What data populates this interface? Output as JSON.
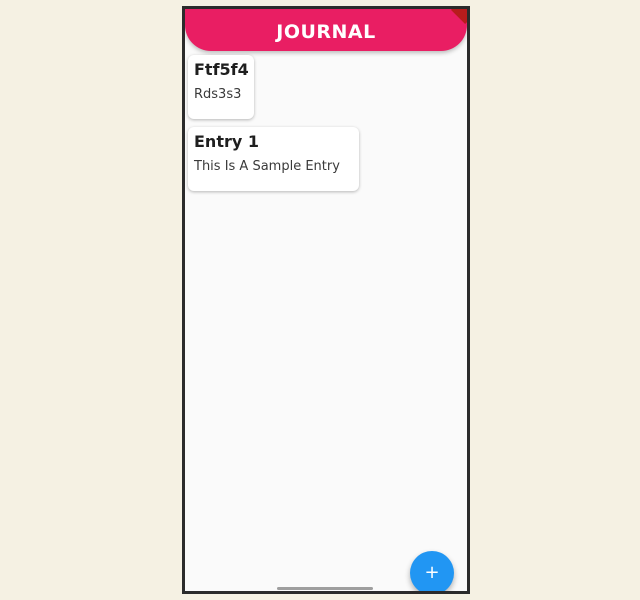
{
  "app_bar": {
    "title": "JOURNAL"
  },
  "entries": [
    {
      "title": "Ftf5f4",
      "body": "Rds3s3"
    },
    {
      "title": "Entry 1",
      "body": "This Is A Sample Entry"
    }
  ],
  "fab": {
    "icon": "plus-icon",
    "glyph": "+"
  },
  "colors": {
    "app_bar": "#e91e63",
    "fab": "#2196f3",
    "page_background": "#fafafa",
    "outer_background": "#f5f1e3"
  }
}
